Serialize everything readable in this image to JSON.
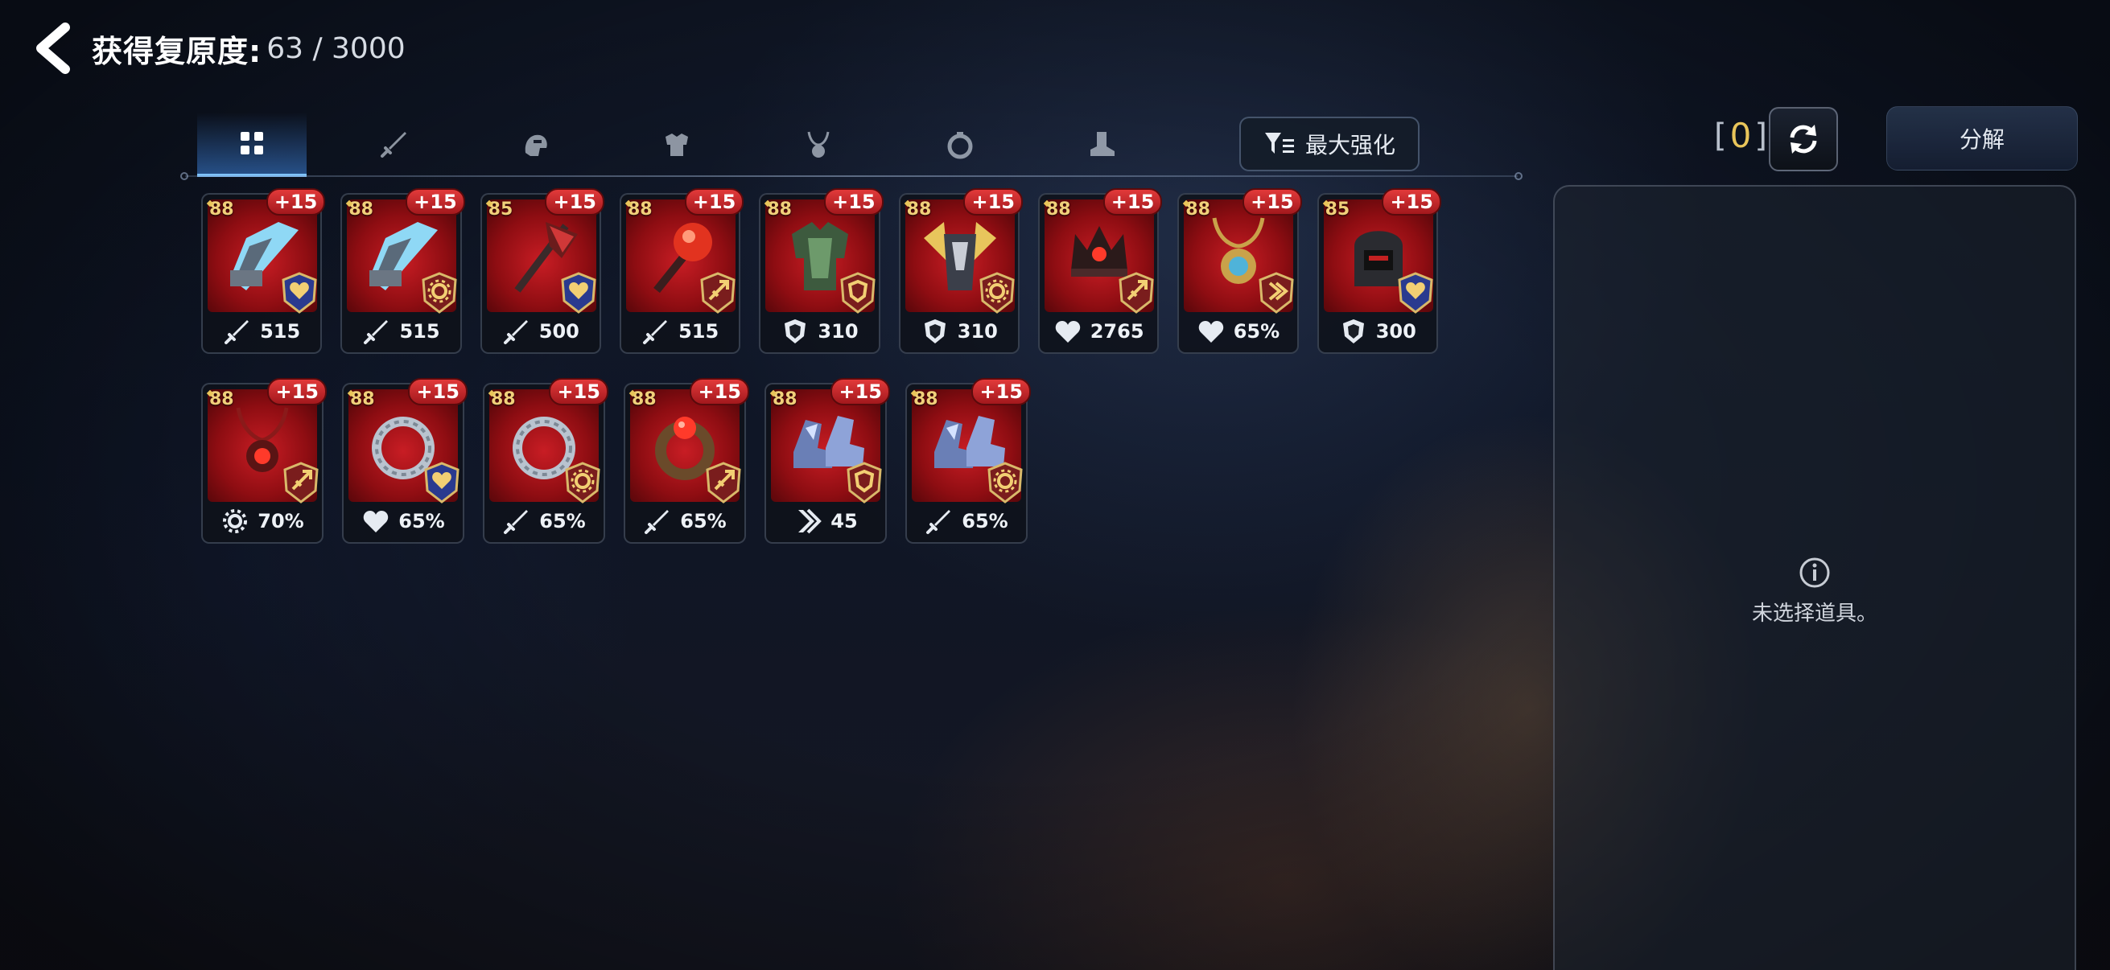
{
  "header": {
    "title": "获得复原度:",
    "progress": "63 / 3000"
  },
  "tabs": [
    {
      "name": "all",
      "icon": "grid-icon",
      "active": true
    },
    {
      "name": "weapon",
      "icon": "sword-icon"
    },
    {
      "name": "helmet",
      "icon": "helmet-icon"
    },
    {
      "name": "armor",
      "icon": "armor-icon"
    },
    {
      "name": "necklace",
      "icon": "necklace-icon"
    },
    {
      "name": "ring",
      "icon": "ring-icon"
    },
    {
      "name": "boots",
      "icon": "boots-icon"
    }
  ],
  "filter": {
    "label": "最大强化",
    "icon": "filter-icon"
  },
  "selection": {
    "open": "[",
    "count": "0",
    "close": "]"
  },
  "decompose": {
    "label": "分解"
  },
  "detail": {
    "empty_text": "未选择道具。",
    "icon": "info-icon"
  },
  "items": [
    [
      {
        "level": "88",
        "enhance": "+15",
        "art": "gauntlet",
        "set": "heart",
        "stat_icon": "attack",
        "stat": "515"
      },
      {
        "level": "88",
        "enhance": "+15",
        "art": "gauntlet",
        "set": "gear",
        "stat_icon": "attack",
        "stat": "515"
      },
      {
        "level": "85",
        "enhance": "+15",
        "art": "axe",
        "set": "heart",
        "stat_icon": "attack",
        "stat": "500"
      },
      {
        "level": "88",
        "enhance": "+15",
        "art": "orb-staff",
        "set": "spear",
        "stat_icon": "attack",
        "stat": "515"
      },
      {
        "level": "88",
        "enhance": "+15",
        "art": "armor",
        "set": "shield",
        "stat_icon": "defense",
        "stat": "310"
      },
      {
        "level": "88",
        "enhance": "+15",
        "art": "winged-armor",
        "set": "gear",
        "stat_icon": "defense",
        "stat": "310"
      },
      {
        "level": "88",
        "enhance": "+15",
        "art": "crown",
        "set": "spear",
        "stat_icon": "health",
        "stat": "2765"
      },
      {
        "level": "88",
        "enhance": "+15",
        "art": "amulet",
        "set": "speed",
        "stat_icon": "health",
        "stat": "65%"
      },
      {
        "level": "85",
        "enhance": "+15",
        "art": "hood",
        "set": "heart",
        "stat_icon": "defense",
        "stat": "300"
      }
    ],
    [
      {
        "level": "88",
        "enhance": "+15",
        "art": "necklace",
        "set": "spear",
        "stat_icon": "gear",
        "stat": "70%"
      },
      {
        "level": "88",
        "enhance": "+15",
        "art": "ring",
        "set": "heart",
        "stat_icon": "health",
        "stat": "65%"
      },
      {
        "level": "88",
        "enhance": "+15",
        "art": "ring",
        "set": "gear",
        "stat_icon": "attack",
        "stat": "65%"
      },
      {
        "level": "88",
        "enhance": "+15",
        "art": "gem-ring",
        "set": "spear",
        "stat_icon": "attack",
        "stat": "65%"
      },
      {
        "level": "88",
        "enhance": "+15",
        "art": "boots",
        "set": "shield",
        "stat_icon": "speed",
        "stat": "45"
      },
      {
        "level": "88",
        "enhance": "+15",
        "art": "boots",
        "set": "gear",
        "stat_icon": "attack",
        "stat": "65%"
      }
    ]
  ]
}
